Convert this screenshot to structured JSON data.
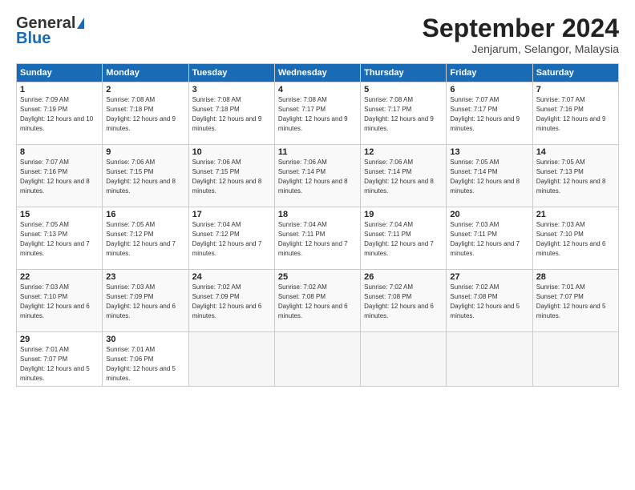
{
  "header": {
    "logo_line1": "General",
    "logo_line2": "Blue",
    "month_title": "September 2024",
    "subtitle": "Jenjarum, Selangor, Malaysia"
  },
  "days_of_week": [
    "Sunday",
    "Monday",
    "Tuesday",
    "Wednesday",
    "Thursday",
    "Friday",
    "Saturday"
  ],
  "weeks": [
    [
      {
        "day": "1",
        "sunrise": "Sunrise: 7:09 AM",
        "sunset": "Sunset: 7:19 PM",
        "daylight": "Daylight: 12 hours and 10 minutes."
      },
      {
        "day": "2",
        "sunrise": "Sunrise: 7:08 AM",
        "sunset": "Sunset: 7:18 PM",
        "daylight": "Daylight: 12 hours and 9 minutes."
      },
      {
        "day": "3",
        "sunrise": "Sunrise: 7:08 AM",
        "sunset": "Sunset: 7:18 PM",
        "daylight": "Daylight: 12 hours and 9 minutes."
      },
      {
        "day": "4",
        "sunrise": "Sunrise: 7:08 AM",
        "sunset": "Sunset: 7:17 PM",
        "daylight": "Daylight: 12 hours and 9 minutes."
      },
      {
        "day": "5",
        "sunrise": "Sunrise: 7:08 AM",
        "sunset": "Sunset: 7:17 PM",
        "daylight": "Daylight: 12 hours and 9 minutes."
      },
      {
        "day": "6",
        "sunrise": "Sunrise: 7:07 AM",
        "sunset": "Sunset: 7:17 PM",
        "daylight": "Daylight: 12 hours and 9 minutes."
      },
      {
        "day": "7",
        "sunrise": "Sunrise: 7:07 AM",
        "sunset": "Sunset: 7:16 PM",
        "daylight": "Daylight: 12 hours and 9 minutes."
      }
    ],
    [
      {
        "day": "8",
        "sunrise": "Sunrise: 7:07 AM",
        "sunset": "Sunset: 7:16 PM",
        "daylight": "Daylight: 12 hours and 8 minutes."
      },
      {
        "day": "9",
        "sunrise": "Sunrise: 7:06 AM",
        "sunset": "Sunset: 7:15 PM",
        "daylight": "Daylight: 12 hours and 8 minutes."
      },
      {
        "day": "10",
        "sunrise": "Sunrise: 7:06 AM",
        "sunset": "Sunset: 7:15 PM",
        "daylight": "Daylight: 12 hours and 8 minutes."
      },
      {
        "day": "11",
        "sunrise": "Sunrise: 7:06 AM",
        "sunset": "Sunset: 7:14 PM",
        "daylight": "Daylight: 12 hours and 8 minutes."
      },
      {
        "day": "12",
        "sunrise": "Sunrise: 7:06 AM",
        "sunset": "Sunset: 7:14 PM",
        "daylight": "Daylight: 12 hours and 8 minutes."
      },
      {
        "day": "13",
        "sunrise": "Sunrise: 7:05 AM",
        "sunset": "Sunset: 7:14 PM",
        "daylight": "Daylight: 12 hours and 8 minutes."
      },
      {
        "day": "14",
        "sunrise": "Sunrise: 7:05 AM",
        "sunset": "Sunset: 7:13 PM",
        "daylight": "Daylight: 12 hours and 8 minutes."
      }
    ],
    [
      {
        "day": "15",
        "sunrise": "Sunrise: 7:05 AM",
        "sunset": "Sunset: 7:13 PM",
        "daylight": "Daylight: 12 hours and 7 minutes."
      },
      {
        "day": "16",
        "sunrise": "Sunrise: 7:05 AM",
        "sunset": "Sunset: 7:12 PM",
        "daylight": "Daylight: 12 hours and 7 minutes."
      },
      {
        "day": "17",
        "sunrise": "Sunrise: 7:04 AM",
        "sunset": "Sunset: 7:12 PM",
        "daylight": "Daylight: 12 hours and 7 minutes."
      },
      {
        "day": "18",
        "sunrise": "Sunrise: 7:04 AM",
        "sunset": "Sunset: 7:11 PM",
        "daylight": "Daylight: 12 hours and 7 minutes."
      },
      {
        "day": "19",
        "sunrise": "Sunrise: 7:04 AM",
        "sunset": "Sunset: 7:11 PM",
        "daylight": "Daylight: 12 hours and 7 minutes."
      },
      {
        "day": "20",
        "sunrise": "Sunrise: 7:03 AM",
        "sunset": "Sunset: 7:11 PM",
        "daylight": "Daylight: 12 hours and 7 minutes."
      },
      {
        "day": "21",
        "sunrise": "Sunrise: 7:03 AM",
        "sunset": "Sunset: 7:10 PM",
        "daylight": "Daylight: 12 hours and 6 minutes."
      }
    ],
    [
      {
        "day": "22",
        "sunrise": "Sunrise: 7:03 AM",
        "sunset": "Sunset: 7:10 PM",
        "daylight": "Daylight: 12 hours and 6 minutes."
      },
      {
        "day": "23",
        "sunrise": "Sunrise: 7:03 AM",
        "sunset": "Sunset: 7:09 PM",
        "daylight": "Daylight: 12 hours and 6 minutes."
      },
      {
        "day": "24",
        "sunrise": "Sunrise: 7:02 AM",
        "sunset": "Sunset: 7:09 PM",
        "daylight": "Daylight: 12 hours and 6 minutes."
      },
      {
        "day": "25",
        "sunrise": "Sunrise: 7:02 AM",
        "sunset": "Sunset: 7:08 PM",
        "daylight": "Daylight: 12 hours and 6 minutes."
      },
      {
        "day": "26",
        "sunrise": "Sunrise: 7:02 AM",
        "sunset": "Sunset: 7:08 PM",
        "daylight": "Daylight: 12 hours and 6 minutes."
      },
      {
        "day": "27",
        "sunrise": "Sunrise: 7:02 AM",
        "sunset": "Sunset: 7:08 PM",
        "daylight": "Daylight: 12 hours and 5 minutes."
      },
      {
        "day": "28",
        "sunrise": "Sunrise: 7:01 AM",
        "sunset": "Sunset: 7:07 PM",
        "daylight": "Daylight: 12 hours and 5 minutes."
      }
    ],
    [
      {
        "day": "29",
        "sunrise": "Sunrise: 7:01 AM",
        "sunset": "Sunset: 7:07 PM",
        "daylight": "Daylight: 12 hours and 5 minutes."
      },
      {
        "day": "30",
        "sunrise": "Sunrise: 7:01 AM",
        "sunset": "Sunset: 7:06 PM",
        "daylight": "Daylight: 12 hours and 5 minutes."
      },
      null,
      null,
      null,
      null,
      null
    ]
  ]
}
